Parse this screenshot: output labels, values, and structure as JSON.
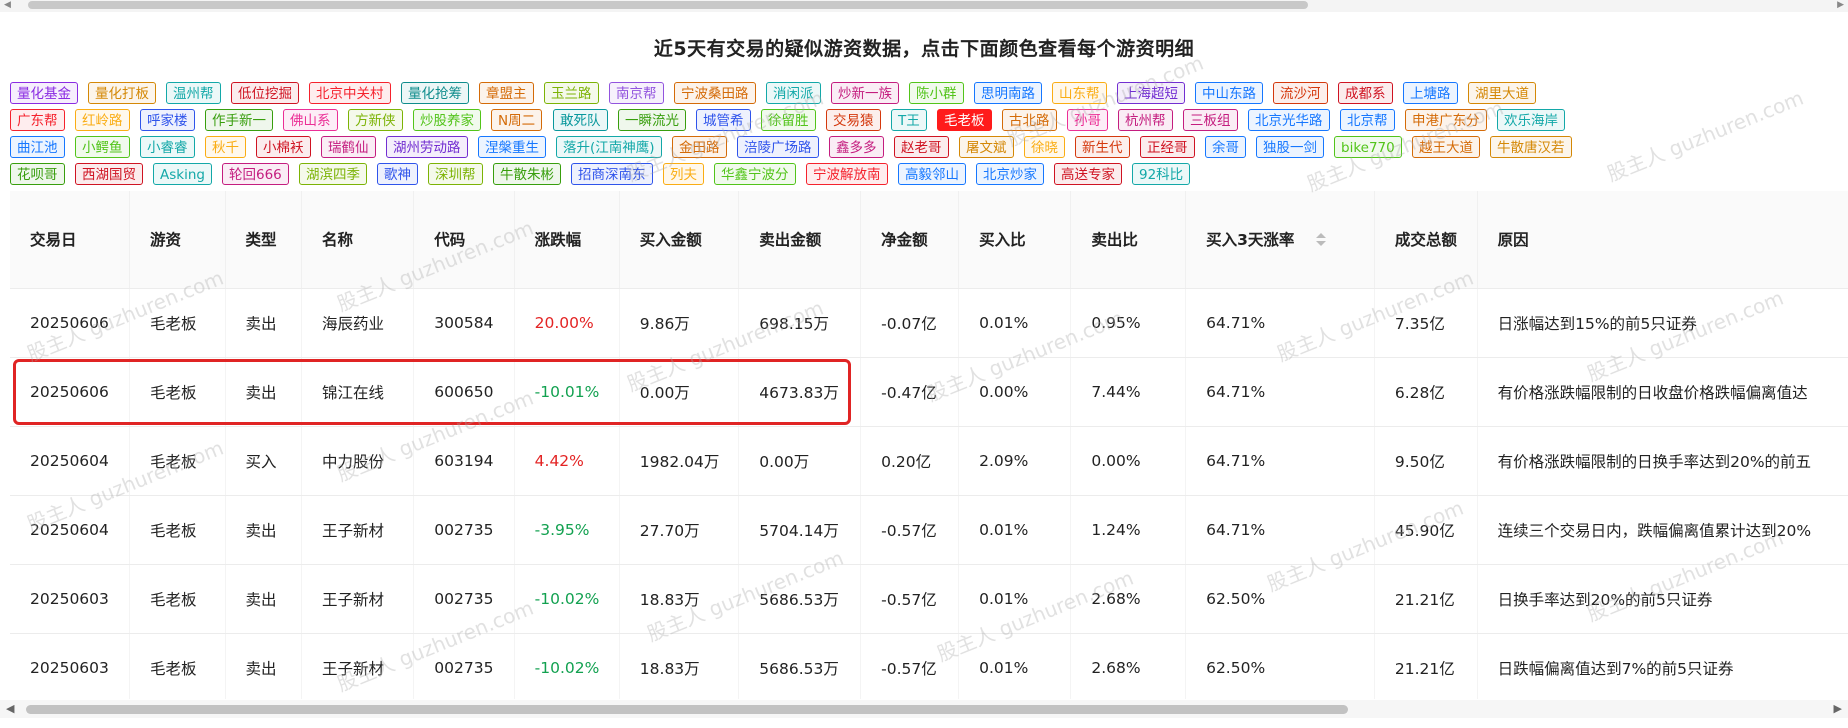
{
  "title": "近5天有交易的疑似游资数据，点击下面颜色查看每个游资明细",
  "watermark": "股主人 guzhuren.com",
  "tag_rows": [
    [
      {
        "label": "量化基金",
        "color": "#8a2be2"
      },
      {
        "label": "量化打板",
        "color": "#d48806"
      },
      {
        "label": "温州帮",
        "color": "#13a8a8"
      },
      {
        "label": "低位挖掘",
        "color": "#cf1322"
      },
      {
        "label": "北京中关村",
        "color": "#f5222d"
      },
      {
        "label": "量化抢筹",
        "color": "#0f8c8c"
      },
      {
        "label": "章盟主",
        "color": "#d46b08"
      },
      {
        "label": "玉兰路",
        "color": "#7cb305"
      },
      {
        "label": "南京帮",
        "color": "#9254de"
      },
      {
        "label": "宁波桑田路",
        "color": "#d46b08"
      },
      {
        "label": "消闲派",
        "color": "#13a8a8"
      },
      {
        "label": "炒新一族",
        "color": "#c41d7f"
      },
      {
        "label": "陈小群",
        "color": "#52c41a"
      },
      {
        "label": "思明南路",
        "color": "#1677ff"
      },
      {
        "label": "山东帮",
        "color": "#faad14"
      },
      {
        "label": "上海超短",
        "color": "#722ed1"
      },
      {
        "label": "中山东路",
        "color": "#1677ff"
      },
      {
        "label": "流沙河",
        "color": "#d4380d"
      },
      {
        "label": "成都系",
        "color": "#cf1322"
      },
      {
        "label": "上塘路",
        "color": "#1677ff"
      },
      {
        "label": "湖里大道",
        "color": "#d48806"
      }
    ],
    [
      {
        "label": "广东帮",
        "color": "#f5222d"
      },
      {
        "label": "红岭路",
        "color": "#faad14"
      },
      {
        "label": "呼家楼",
        "color": "#2f54eb"
      },
      {
        "label": "作手新一",
        "color": "#389e0d"
      },
      {
        "label": "佛山系",
        "color": "#eb2f96"
      },
      {
        "label": "方新侠",
        "color": "#7cb305"
      },
      {
        "label": "炒股养家",
        "color": "#52c41a"
      },
      {
        "label": "N周二",
        "color": "#d46b08"
      },
      {
        "label": "敢死队",
        "color": "#08979c"
      },
      {
        "label": "一瞬流光",
        "color": "#389e0d"
      },
      {
        "label": "城管希",
        "color": "#2f54eb"
      },
      {
        "label": "徐留胜",
        "color": "#52c41a"
      },
      {
        "label": "交易猿",
        "color": "#d4380d"
      },
      {
        "label": "T王",
        "color": "#13a8a8"
      },
      {
        "label": "毛老板",
        "color": "#ff1b1b",
        "active": true
      },
      {
        "label": "古北路",
        "color": "#d46b08"
      },
      {
        "label": "孙哥",
        "color": "#eb2f96"
      },
      {
        "label": "杭州帮",
        "color": "#c41d7f"
      },
      {
        "label": "三板组",
        "color": "#c41d7f"
      },
      {
        "label": "北京光华路",
        "color": "#1677ff"
      },
      {
        "label": "北京帮",
        "color": "#1677ff"
      },
      {
        "label": "申港广东分",
        "color": "#d46b08"
      },
      {
        "label": "欢乐海岸",
        "color": "#13a8a8"
      }
    ],
    [
      {
        "label": "曲江池",
        "color": "#1677ff"
      },
      {
        "label": "小鳄鱼",
        "color": "#52c41a"
      },
      {
        "label": "小睿睿",
        "color": "#13a8a8"
      },
      {
        "label": "秋千",
        "color": "#faad14"
      },
      {
        "label": "小棉袄",
        "color": "#cf1322"
      },
      {
        "label": "瑞鹤仙",
        "color": "#c41d7f"
      },
      {
        "label": "湖州劳动路",
        "color": "#722ed1"
      },
      {
        "label": "涅槃重生",
        "color": "#1677ff"
      },
      {
        "label": "落升(江南神鹰)",
        "color": "#13a8a8"
      },
      {
        "label": "金田路",
        "color": "#d46b08"
      },
      {
        "label": "涪陵广场路",
        "color": "#2f54eb"
      },
      {
        "label": "鑫多多",
        "color": "#c41d7f"
      },
      {
        "label": "赵老哥",
        "color": "#cf1322"
      },
      {
        "label": "屠文斌",
        "color": "#d48806"
      },
      {
        "label": "徐晓",
        "color": "#faad14"
      },
      {
        "label": "新生代",
        "color": "#d4380d"
      },
      {
        "label": "正经哥",
        "color": "#cf1322"
      },
      {
        "label": "余哥",
        "color": "#1677ff"
      },
      {
        "label": "独股一剑",
        "color": "#1677ff"
      },
      {
        "label": "bike770",
        "color": "#52c41a"
      },
      {
        "label": "越王大道",
        "color": "#d46b08"
      },
      {
        "label": "牛散唐汉若",
        "color": "#d48806"
      }
    ],
    [
      {
        "label": "花呗哥",
        "color": "#389e0d"
      },
      {
        "label": "西湖国贸",
        "color": "#cf1322"
      },
      {
        "label": "Asking",
        "color": "#13a8a8"
      },
      {
        "label": "轮回666",
        "color": "#c41d7f"
      },
      {
        "label": "湖滨四季",
        "color": "#7cb305"
      },
      {
        "label": "歌神",
        "color": "#2f54eb"
      },
      {
        "label": "深圳帮",
        "color": "#7cb305"
      },
      {
        "label": "牛散朱彬",
        "color": "#389e0d"
      },
      {
        "label": "招商深南东",
        "color": "#2f54eb"
      },
      {
        "label": "列夫",
        "color": "#faad14"
      },
      {
        "label": "华鑫宁波分",
        "color": "#52c41a"
      },
      {
        "label": "宁波解放南",
        "color": "#f5222d"
      },
      {
        "label": "高毅邻山",
        "color": "#1677ff"
      },
      {
        "label": "北京炒家",
        "color": "#1677ff"
      },
      {
        "label": "高送专家",
        "color": "#cf1322"
      },
      {
        "label": "92科比",
        "color": "#13a8a8"
      }
    ]
  ],
  "table": {
    "headers": [
      "交易日",
      "游资",
      "类型",
      "名称",
      "代码",
      "涨跌幅",
      "买入金额",
      "卖出金额",
      "净金额",
      "买入比",
      "卖出比",
      "买入3天涨率",
      "成交总额",
      "原因"
    ],
    "rows": [
      {
        "date": "20250606",
        "trader": "毛老板",
        "type": "卖出",
        "name": "海辰药业",
        "code": "300584",
        "change": "20.00%",
        "dir": "pos",
        "buy": "9.86万",
        "sell": "698.15万",
        "net": "-0.07亿",
        "buy_ratio": "0.01%",
        "sell_ratio": "0.95%",
        "rise3": "64.71%",
        "volume": "7.35亿",
        "reason": "日涨幅达到15%的前5只证券"
      },
      {
        "date": "20250606",
        "trader": "毛老板",
        "type": "卖出",
        "name": "锦江在线",
        "code": "600650",
        "change": "-10.01%",
        "dir": "neg",
        "buy": "0.00万",
        "sell": "4673.83万",
        "net": "-0.47亿",
        "buy_ratio": "0.00%",
        "sell_ratio": "7.44%",
        "rise3": "64.71%",
        "volume": "6.28亿",
        "reason": "有价格涨跌幅限制的日收盘价格跌幅偏离值达"
      },
      {
        "date": "20250604",
        "trader": "毛老板",
        "type": "买入",
        "name": "中力股份",
        "code": "603194",
        "change": "4.42%",
        "dir": "pos",
        "buy": "1982.04万",
        "sell": "0.00万",
        "net": "0.20亿",
        "buy_ratio": "2.09%",
        "sell_ratio": "0.00%",
        "rise3": "64.71%",
        "volume": "9.50亿",
        "reason": "有价格涨跌幅限制的日换手率达到20%的前五"
      },
      {
        "date": "20250604",
        "trader": "毛老板",
        "type": "卖出",
        "name": "王子新材",
        "code": "002735",
        "change": "-3.95%",
        "dir": "neg",
        "buy": "27.70万",
        "sell": "5704.14万",
        "net": "-0.57亿",
        "buy_ratio": "0.01%",
        "sell_ratio": "1.24%",
        "rise3": "64.71%",
        "volume": "45.90亿",
        "reason": "连续三个交易日内，跌幅偏离值累计达到20%"
      },
      {
        "date": "20250603",
        "trader": "毛老板",
        "type": "卖出",
        "name": "王子新材",
        "code": "002735",
        "change": "-10.02%",
        "dir": "neg",
        "buy": "18.83万",
        "sell": "5686.53万",
        "net": "-0.57亿",
        "buy_ratio": "0.01%",
        "sell_ratio": "2.68%",
        "rise3": "62.50%",
        "volume": "21.21亿",
        "reason": "日换手率达到20%的前5只证券"
      },
      {
        "date": "20250603",
        "trader": "毛老板",
        "type": "卖出",
        "name": "王子新材",
        "code": "002735",
        "change": "-10.02%",
        "dir": "neg",
        "buy": "18.83万",
        "sell": "5686.53万",
        "net": "-0.57亿",
        "buy_ratio": "0.01%",
        "sell_ratio": "2.68%",
        "rise3": "62.50%",
        "volume": "21.21亿",
        "reason": "日跌幅偏离值达到7%的前5只证券"
      }
    ]
  },
  "colors": {
    "accent_active": "#ff1b1b",
    "positive": "#e32424",
    "negative": "#12a150",
    "highlight_box": "#e02424"
  }
}
